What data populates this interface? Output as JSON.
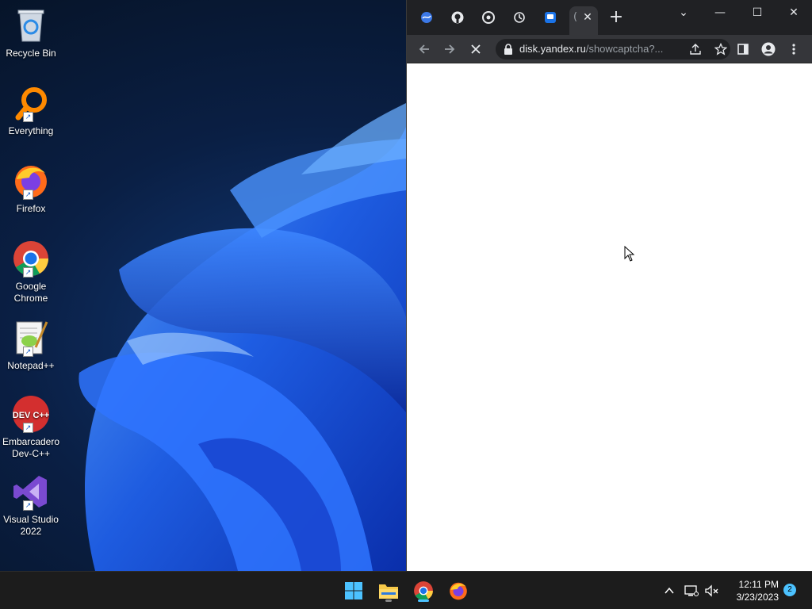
{
  "desktop": {
    "icons": [
      {
        "label": "Recycle Bin"
      },
      {
        "label": "Everything"
      },
      {
        "label": "Firefox"
      },
      {
        "label": "Google Chrome"
      },
      {
        "label": "Notepad++"
      },
      {
        "label": "Embarcadero Dev-C++"
      },
      {
        "label": "Visual Studio 2022"
      }
    ],
    "devcpp_logo_text": "DEV C++"
  },
  "browser": {
    "url_host": "disk.yandex.ru",
    "url_path": "/showcaptcha?...",
    "tab_partial_text": "(",
    "tab_close_glyph": "✕",
    "new_tab_glyph": "+",
    "window_controls": {
      "tab_search": "⌄",
      "minimize": "—",
      "maximize": "☐",
      "close": "✕"
    }
  },
  "taskbar": {
    "time": "12:11 PM",
    "date": "3/23/2023",
    "notification_count": "2"
  },
  "colors": {
    "chrome_tabstrip": "#202124",
    "chrome_toolbar": "#35363a",
    "taskbar": "#1c1c1c",
    "accent": "#4cc2ff"
  }
}
